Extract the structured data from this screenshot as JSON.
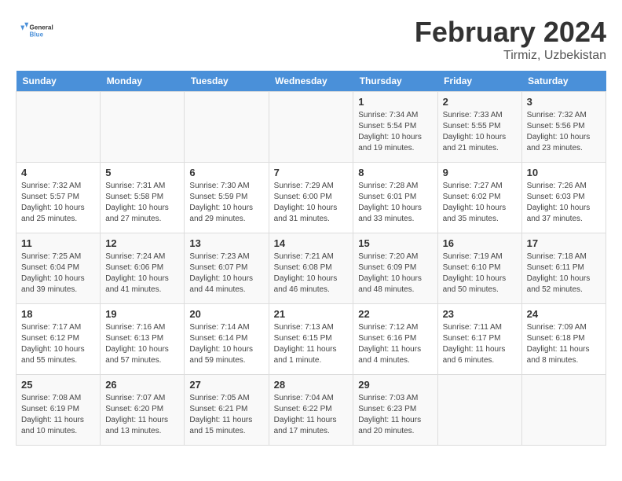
{
  "header": {
    "logo_general": "General",
    "logo_blue": "Blue",
    "title": "February 2024",
    "subtitle": "Tirmiz, Uzbekistan"
  },
  "days_of_week": [
    "Sunday",
    "Monday",
    "Tuesday",
    "Wednesday",
    "Thursday",
    "Friday",
    "Saturday"
  ],
  "weeks": [
    [
      {
        "day": "",
        "info": ""
      },
      {
        "day": "",
        "info": ""
      },
      {
        "day": "",
        "info": ""
      },
      {
        "day": "",
        "info": ""
      },
      {
        "day": "1",
        "info": "Sunrise: 7:34 AM\nSunset: 5:54 PM\nDaylight: 10 hours and 19 minutes."
      },
      {
        "day": "2",
        "info": "Sunrise: 7:33 AM\nSunset: 5:55 PM\nDaylight: 10 hours and 21 minutes."
      },
      {
        "day": "3",
        "info": "Sunrise: 7:32 AM\nSunset: 5:56 PM\nDaylight: 10 hours and 23 minutes."
      }
    ],
    [
      {
        "day": "4",
        "info": "Sunrise: 7:32 AM\nSunset: 5:57 PM\nDaylight: 10 hours and 25 minutes."
      },
      {
        "day": "5",
        "info": "Sunrise: 7:31 AM\nSunset: 5:58 PM\nDaylight: 10 hours and 27 minutes."
      },
      {
        "day": "6",
        "info": "Sunrise: 7:30 AM\nSunset: 5:59 PM\nDaylight: 10 hours and 29 minutes."
      },
      {
        "day": "7",
        "info": "Sunrise: 7:29 AM\nSunset: 6:00 PM\nDaylight: 10 hours and 31 minutes."
      },
      {
        "day": "8",
        "info": "Sunrise: 7:28 AM\nSunset: 6:01 PM\nDaylight: 10 hours and 33 minutes."
      },
      {
        "day": "9",
        "info": "Sunrise: 7:27 AM\nSunset: 6:02 PM\nDaylight: 10 hours and 35 minutes."
      },
      {
        "day": "10",
        "info": "Sunrise: 7:26 AM\nSunset: 6:03 PM\nDaylight: 10 hours and 37 minutes."
      }
    ],
    [
      {
        "day": "11",
        "info": "Sunrise: 7:25 AM\nSunset: 6:04 PM\nDaylight: 10 hours and 39 minutes."
      },
      {
        "day": "12",
        "info": "Sunrise: 7:24 AM\nSunset: 6:06 PM\nDaylight: 10 hours and 41 minutes."
      },
      {
        "day": "13",
        "info": "Sunrise: 7:23 AM\nSunset: 6:07 PM\nDaylight: 10 hours and 44 minutes."
      },
      {
        "day": "14",
        "info": "Sunrise: 7:21 AM\nSunset: 6:08 PM\nDaylight: 10 hours and 46 minutes."
      },
      {
        "day": "15",
        "info": "Sunrise: 7:20 AM\nSunset: 6:09 PM\nDaylight: 10 hours and 48 minutes."
      },
      {
        "day": "16",
        "info": "Sunrise: 7:19 AM\nSunset: 6:10 PM\nDaylight: 10 hours and 50 minutes."
      },
      {
        "day": "17",
        "info": "Sunrise: 7:18 AM\nSunset: 6:11 PM\nDaylight: 10 hours and 52 minutes."
      }
    ],
    [
      {
        "day": "18",
        "info": "Sunrise: 7:17 AM\nSunset: 6:12 PM\nDaylight: 10 hours and 55 minutes."
      },
      {
        "day": "19",
        "info": "Sunrise: 7:16 AM\nSunset: 6:13 PM\nDaylight: 10 hours and 57 minutes."
      },
      {
        "day": "20",
        "info": "Sunrise: 7:14 AM\nSunset: 6:14 PM\nDaylight: 10 hours and 59 minutes."
      },
      {
        "day": "21",
        "info": "Sunrise: 7:13 AM\nSunset: 6:15 PM\nDaylight: 11 hours and 1 minute."
      },
      {
        "day": "22",
        "info": "Sunrise: 7:12 AM\nSunset: 6:16 PM\nDaylight: 11 hours and 4 minutes."
      },
      {
        "day": "23",
        "info": "Sunrise: 7:11 AM\nSunset: 6:17 PM\nDaylight: 11 hours and 6 minutes."
      },
      {
        "day": "24",
        "info": "Sunrise: 7:09 AM\nSunset: 6:18 PM\nDaylight: 11 hours and 8 minutes."
      }
    ],
    [
      {
        "day": "25",
        "info": "Sunrise: 7:08 AM\nSunset: 6:19 PM\nDaylight: 11 hours and 10 minutes."
      },
      {
        "day": "26",
        "info": "Sunrise: 7:07 AM\nSunset: 6:20 PM\nDaylight: 11 hours and 13 minutes."
      },
      {
        "day": "27",
        "info": "Sunrise: 7:05 AM\nSunset: 6:21 PM\nDaylight: 11 hours and 15 minutes."
      },
      {
        "day": "28",
        "info": "Sunrise: 7:04 AM\nSunset: 6:22 PM\nDaylight: 11 hours and 17 minutes."
      },
      {
        "day": "29",
        "info": "Sunrise: 7:03 AM\nSunset: 6:23 PM\nDaylight: 11 hours and 20 minutes."
      },
      {
        "day": "",
        "info": ""
      },
      {
        "day": "",
        "info": ""
      }
    ]
  ]
}
